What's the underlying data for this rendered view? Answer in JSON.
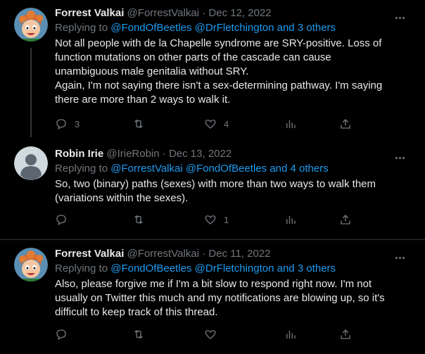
{
  "tweets": [
    {
      "name": "Forrest Valkai",
      "handle": "@ForrestValkai",
      "sep": "·",
      "date": "Dec 12, 2022",
      "replying_prefix": "Replying to",
      "replying_users": "@FondOfBeetles @DrFletchington",
      "replying_and": "and",
      "replying_others": "3 others",
      "body": [
        "Not all people with de la Chapelle syndrome are SRY-positive. Loss of",
        "function mutations on other parts of the cascade can cause",
        "unambiguous male genitalia without SRY.",
        "Again, I'm not saying there isn't a sex-determining pathway. I'm saying",
        "there are more than 2 ways to walk it."
      ],
      "replies": "3",
      "retweets": "",
      "likes": "4"
    },
    {
      "name": "Robin Irie",
      "handle": "@IrieRobin",
      "sep": "·",
      "date": "Dec 13, 2022",
      "replying_prefix": "Replying to",
      "replying_users": "@ForrestValkai @FondOfBeetles",
      "replying_and": "and",
      "replying_others": "4 others",
      "body": [
        "So, two (binary) paths (sexes) with more than two ways to walk them",
        "(variations within the sexes)."
      ],
      "replies": "",
      "retweets": "",
      "likes": "1"
    },
    {
      "name": "Forrest Valkai",
      "handle": "@ForrestValkai",
      "sep": "·",
      "date": "Dec 11, 2022",
      "replying_prefix": "Replying to",
      "replying_users": "@FondOfBeetles @DrFletchington",
      "replying_and": "and",
      "replying_others": "3 others",
      "body": [
        "Also, please forgive me if I'm a bit slow to respond right now. I'm not",
        "usually on Twitter this much and my notifications are blowing up, so it's",
        "difficult to keep track of this thread."
      ],
      "replies": "",
      "retweets": "",
      "likes": ""
    }
  ],
  "colors": {
    "background": "#000000",
    "text": "#e7e9ea",
    "muted": "#71767b",
    "link": "#1d9bf0",
    "divider": "#2f3336"
  }
}
